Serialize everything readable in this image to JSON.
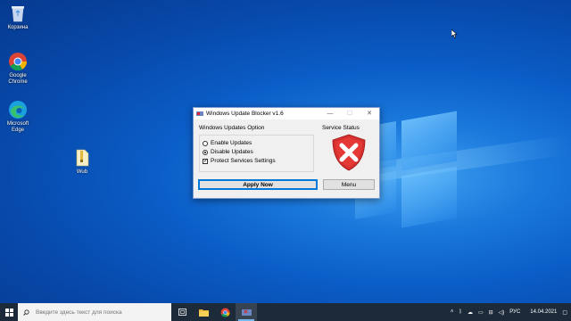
{
  "desktop": {
    "icons": [
      {
        "label": "Корзина",
        "icon": "recycle-bin-icon"
      },
      {
        "label": "Google Chrome",
        "icon": "chrome-icon"
      },
      {
        "label": "Microsoft Edge",
        "icon": "edge-icon"
      },
      {
        "label": "Wub",
        "icon": "wub-zip-icon"
      }
    ]
  },
  "dialog": {
    "title": "Windows Update Blocker v1.6",
    "options_group_label": "Windows Updates Option",
    "service_status_label": "Service Status",
    "options": [
      {
        "label": "Enable Updates",
        "selected": false
      },
      {
        "label": "Disable Updates",
        "selected": true
      }
    ],
    "protect_label": "Protect Services Settings",
    "protect_checked": true,
    "apply_label": "Apply Now",
    "menu_label": "Menu",
    "status_color": "#d32f2f"
  },
  "taskbar": {
    "search_placeholder": "Введите здесь текст для поиска",
    "apps": [
      "file-explorer-icon",
      "chrome-icon",
      "wub-icon"
    ],
    "tray": {
      "language": "РУС",
      "date": "14.04.2021"
    }
  },
  "colors": {
    "accent": "#0078d7",
    "taskbar": "#1c2a3a"
  }
}
